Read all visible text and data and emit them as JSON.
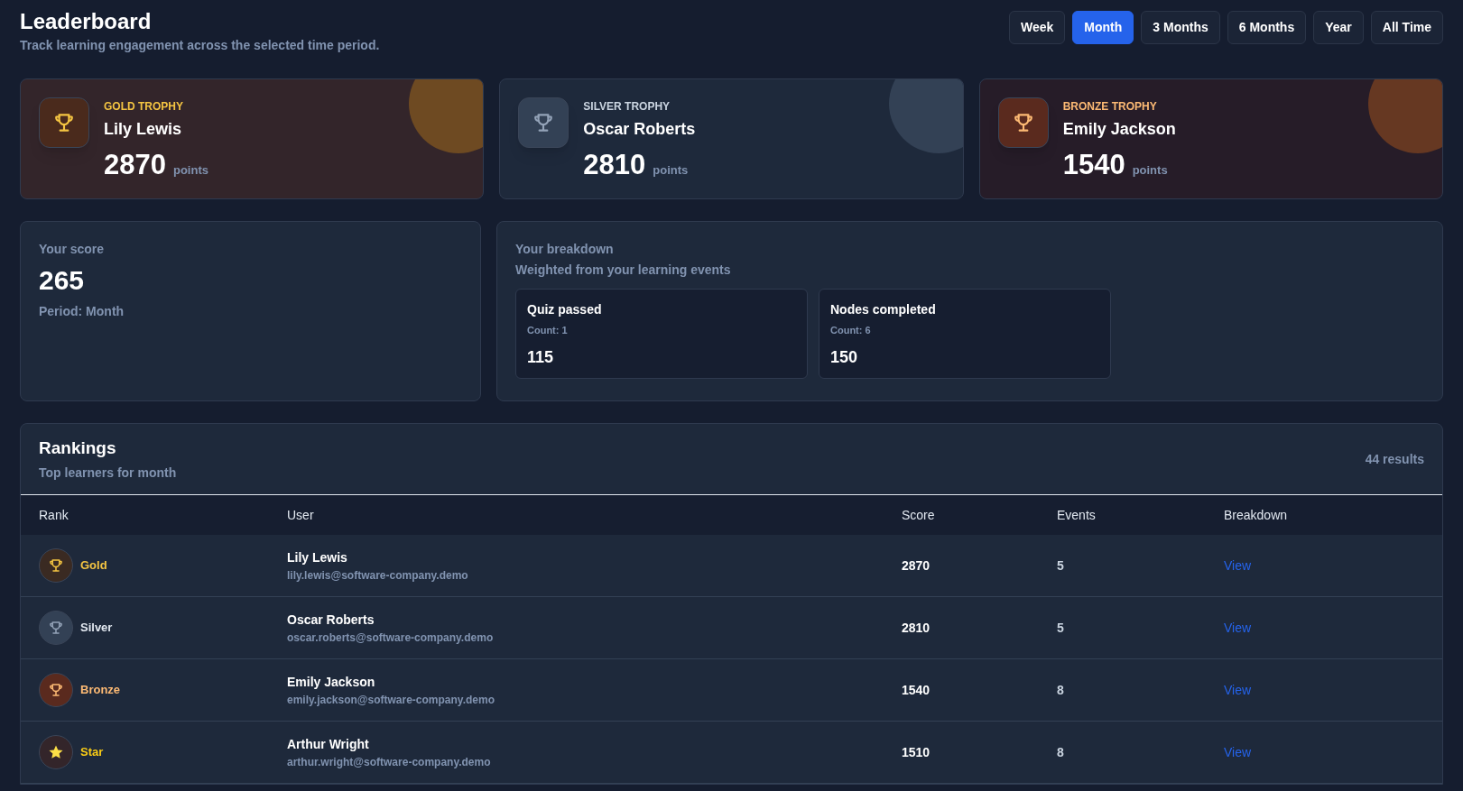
{
  "header": {
    "title": "Leaderboard",
    "subtitle": "Track learning engagement across the selected time period."
  },
  "periods": [
    {
      "label": "Week",
      "selected": false
    },
    {
      "label": "Month",
      "selected": true
    },
    {
      "label": "3 Months",
      "selected": false
    },
    {
      "label": "6 Months",
      "selected": false
    },
    {
      "label": "Year",
      "selected": false
    },
    {
      "label": "All Time",
      "selected": false
    }
  ],
  "trophies": [
    {
      "kind": "gold",
      "label": "GOLD TROPHY",
      "name": "Lily Lewis",
      "points": "2870",
      "unit": "points"
    },
    {
      "kind": "silver",
      "label": "SILVER TROPHY",
      "name": "Oscar Roberts",
      "points": "2810",
      "unit": "points"
    },
    {
      "kind": "bronze",
      "label": "BRONZE TROPHY",
      "name": "Emily Jackson",
      "points": "1540",
      "unit": "points"
    }
  ],
  "your_score": {
    "label": "Your score",
    "value": "265",
    "period": "Period: Month"
  },
  "breakdown": {
    "title": "Your breakdown",
    "subtitle": "Weighted from your learning events",
    "items": [
      {
        "name": "Quiz passed",
        "count": "Count: 1",
        "value": "115"
      },
      {
        "name": "Nodes completed",
        "count": "Count: 6",
        "value": "150"
      }
    ]
  },
  "rankings": {
    "title": "Rankings",
    "subtitle": "Top learners for month",
    "results": "44 results",
    "columns": [
      "Rank",
      "User",
      "Score",
      "Events",
      "Breakdown"
    ],
    "rows": [
      {
        "kind": "gold",
        "rank": "Gold",
        "name": "Lily Lewis",
        "email": "lily.lewis@software-company.demo",
        "score": "2870",
        "events": "5",
        "link": "View"
      },
      {
        "kind": "silver",
        "rank": "Silver",
        "name": "Oscar Roberts",
        "email": "oscar.roberts@software-company.demo",
        "score": "2810",
        "events": "5",
        "link": "View"
      },
      {
        "kind": "bronze",
        "rank": "Bronze",
        "name": "Emily Jackson",
        "email": "emily.jackson@software-company.demo",
        "score": "1540",
        "events": "8",
        "link": "View"
      },
      {
        "kind": "star",
        "rank": "Star",
        "name": "Arthur Wright",
        "email": "arthur.wright@software-company.demo",
        "score": "1510",
        "events": "8",
        "link": "View"
      }
    ]
  }
}
